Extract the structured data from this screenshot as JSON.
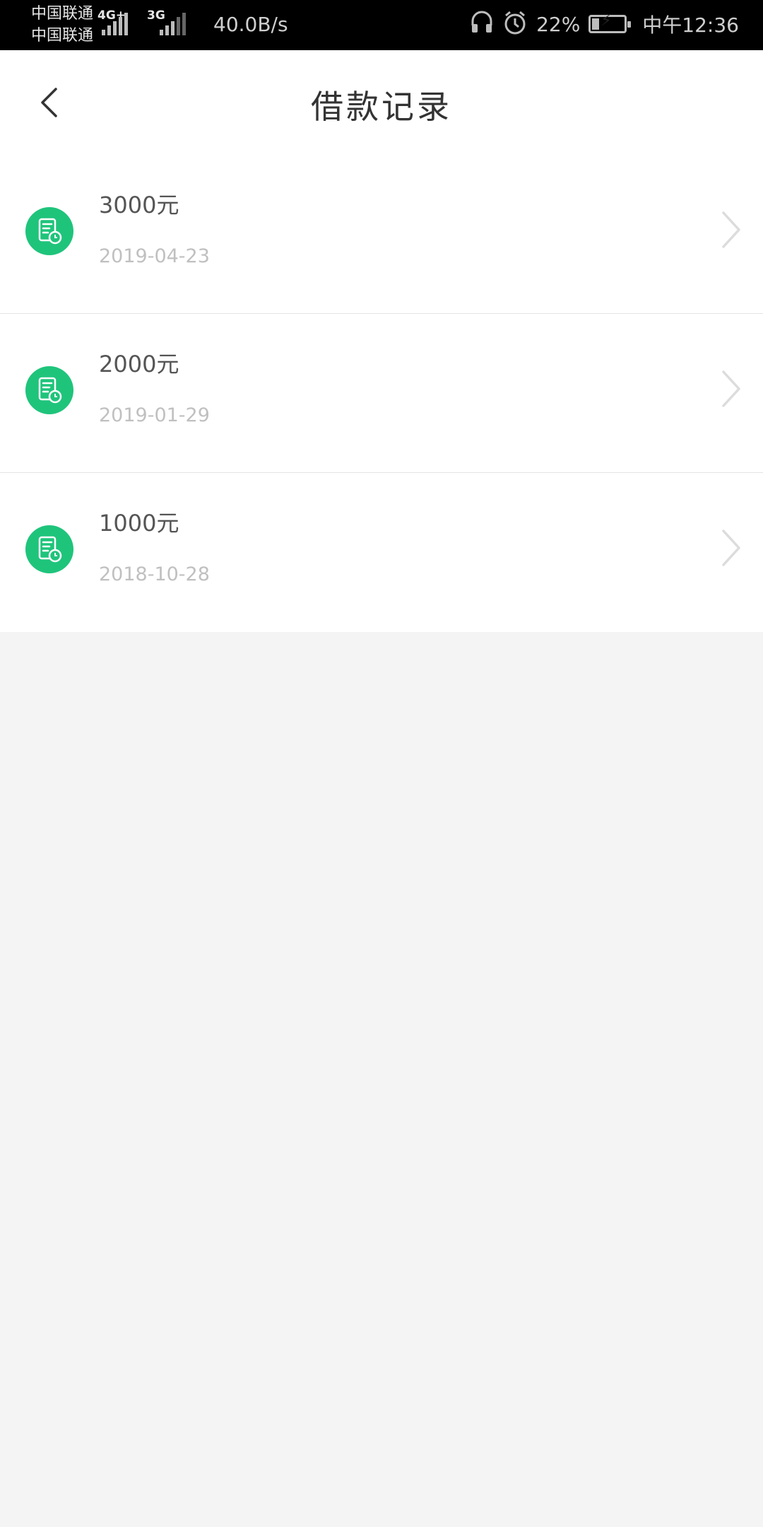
{
  "status_bar": {
    "carrier_1": "中国联通",
    "carrier_2": "中国联通",
    "net_type_1": "4G+",
    "net_type_2": "3G",
    "speed": "40.0B/s",
    "battery": "22%",
    "time": "中午12:36",
    "icons": [
      "headphones-icon",
      "alarm-icon",
      "battery-charging-icon"
    ]
  },
  "header": {
    "title": "借款记录",
    "back_icon": "chevron-left-icon"
  },
  "records": [
    {
      "amount": "3000元",
      "date": "2019-04-23"
    },
    {
      "amount": "2000元",
      "date": "2019-01-29"
    },
    {
      "amount": "1000元",
      "date": "2018-10-28"
    }
  ],
  "colors": {
    "accent": "#1fc47b",
    "background": "#f4f4f4",
    "status_bar": "#000000",
    "date_text": "#c0c0c0"
  }
}
